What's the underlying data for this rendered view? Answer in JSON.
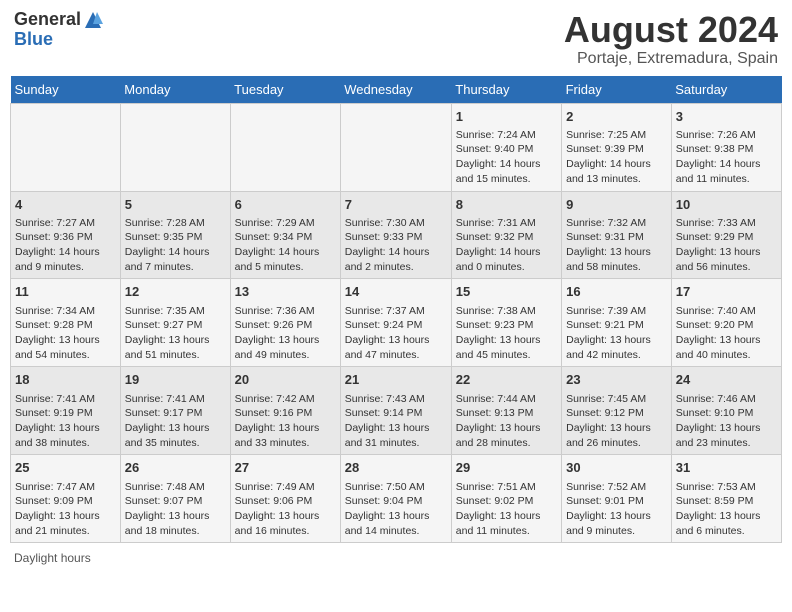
{
  "header": {
    "logo_general": "General",
    "logo_blue": "Blue",
    "month_year": "August 2024",
    "location": "Portaje, Extremadura, Spain"
  },
  "footer": {
    "daylight_label": "Daylight hours"
  },
  "days_of_week": [
    "Sunday",
    "Monday",
    "Tuesday",
    "Wednesday",
    "Thursday",
    "Friday",
    "Saturday"
  ],
  "weeks": [
    {
      "days": [
        {
          "num": "",
          "info": ""
        },
        {
          "num": "",
          "info": ""
        },
        {
          "num": "",
          "info": ""
        },
        {
          "num": "",
          "info": ""
        },
        {
          "num": "1",
          "info": "Sunrise: 7:24 AM\nSunset: 9:40 PM\nDaylight: 14 hours\nand 15 minutes."
        },
        {
          "num": "2",
          "info": "Sunrise: 7:25 AM\nSunset: 9:39 PM\nDaylight: 14 hours\nand 13 minutes."
        },
        {
          "num": "3",
          "info": "Sunrise: 7:26 AM\nSunset: 9:38 PM\nDaylight: 14 hours\nand 11 minutes."
        }
      ]
    },
    {
      "days": [
        {
          "num": "4",
          "info": "Sunrise: 7:27 AM\nSunset: 9:36 PM\nDaylight: 14 hours\nand 9 minutes."
        },
        {
          "num": "5",
          "info": "Sunrise: 7:28 AM\nSunset: 9:35 PM\nDaylight: 14 hours\nand 7 minutes."
        },
        {
          "num": "6",
          "info": "Sunrise: 7:29 AM\nSunset: 9:34 PM\nDaylight: 14 hours\nand 5 minutes."
        },
        {
          "num": "7",
          "info": "Sunrise: 7:30 AM\nSunset: 9:33 PM\nDaylight: 14 hours\nand 2 minutes."
        },
        {
          "num": "8",
          "info": "Sunrise: 7:31 AM\nSunset: 9:32 PM\nDaylight: 14 hours\nand 0 minutes."
        },
        {
          "num": "9",
          "info": "Sunrise: 7:32 AM\nSunset: 9:31 PM\nDaylight: 13 hours\nand 58 minutes."
        },
        {
          "num": "10",
          "info": "Sunrise: 7:33 AM\nSunset: 9:29 PM\nDaylight: 13 hours\nand 56 minutes."
        }
      ]
    },
    {
      "days": [
        {
          "num": "11",
          "info": "Sunrise: 7:34 AM\nSunset: 9:28 PM\nDaylight: 13 hours\nand 54 minutes."
        },
        {
          "num": "12",
          "info": "Sunrise: 7:35 AM\nSunset: 9:27 PM\nDaylight: 13 hours\nand 51 minutes."
        },
        {
          "num": "13",
          "info": "Sunrise: 7:36 AM\nSunset: 9:26 PM\nDaylight: 13 hours\nand 49 minutes."
        },
        {
          "num": "14",
          "info": "Sunrise: 7:37 AM\nSunset: 9:24 PM\nDaylight: 13 hours\nand 47 minutes."
        },
        {
          "num": "15",
          "info": "Sunrise: 7:38 AM\nSunset: 9:23 PM\nDaylight: 13 hours\nand 45 minutes."
        },
        {
          "num": "16",
          "info": "Sunrise: 7:39 AM\nSunset: 9:21 PM\nDaylight: 13 hours\nand 42 minutes."
        },
        {
          "num": "17",
          "info": "Sunrise: 7:40 AM\nSunset: 9:20 PM\nDaylight: 13 hours\nand 40 minutes."
        }
      ]
    },
    {
      "days": [
        {
          "num": "18",
          "info": "Sunrise: 7:41 AM\nSunset: 9:19 PM\nDaylight: 13 hours\nand 38 minutes."
        },
        {
          "num": "19",
          "info": "Sunrise: 7:41 AM\nSunset: 9:17 PM\nDaylight: 13 hours\nand 35 minutes."
        },
        {
          "num": "20",
          "info": "Sunrise: 7:42 AM\nSunset: 9:16 PM\nDaylight: 13 hours\nand 33 minutes."
        },
        {
          "num": "21",
          "info": "Sunrise: 7:43 AM\nSunset: 9:14 PM\nDaylight: 13 hours\nand 31 minutes."
        },
        {
          "num": "22",
          "info": "Sunrise: 7:44 AM\nSunset: 9:13 PM\nDaylight: 13 hours\nand 28 minutes."
        },
        {
          "num": "23",
          "info": "Sunrise: 7:45 AM\nSunset: 9:12 PM\nDaylight: 13 hours\nand 26 minutes."
        },
        {
          "num": "24",
          "info": "Sunrise: 7:46 AM\nSunset: 9:10 PM\nDaylight: 13 hours\nand 23 minutes."
        }
      ]
    },
    {
      "days": [
        {
          "num": "25",
          "info": "Sunrise: 7:47 AM\nSunset: 9:09 PM\nDaylight: 13 hours\nand 21 minutes."
        },
        {
          "num": "26",
          "info": "Sunrise: 7:48 AM\nSunset: 9:07 PM\nDaylight: 13 hours\nand 18 minutes."
        },
        {
          "num": "27",
          "info": "Sunrise: 7:49 AM\nSunset: 9:06 PM\nDaylight: 13 hours\nand 16 minutes."
        },
        {
          "num": "28",
          "info": "Sunrise: 7:50 AM\nSunset: 9:04 PM\nDaylight: 13 hours\nand 14 minutes."
        },
        {
          "num": "29",
          "info": "Sunrise: 7:51 AM\nSunset: 9:02 PM\nDaylight: 13 hours\nand 11 minutes."
        },
        {
          "num": "30",
          "info": "Sunrise: 7:52 AM\nSunset: 9:01 PM\nDaylight: 13 hours\nand 9 minutes."
        },
        {
          "num": "31",
          "info": "Sunrise: 7:53 AM\nSunset: 8:59 PM\nDaylight: 13 hours\nand 6 minutes."
        }
      ]
    }
  ]
}
